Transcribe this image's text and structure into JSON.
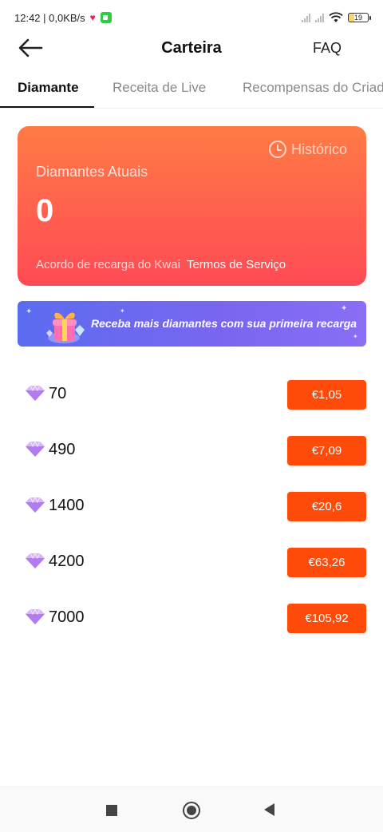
{
  "status_bar": {
    "time_speed": "12:42 | 0,0KB/s",
    "battery": "19"
  },
  "header": {
    "title": "Carteira",
    "faq_label": "FAQ"
  },
  "tabs": [
    {
      "label": "Diamante",
      "active": true
    },
    {
      "label": "Receita de Live",
      "active": false
    },
    {
      "label": "Recompensas do Criador",
      "active": false
    }
  ],
  "wallet_card": {
    "history_label": "Histórico",
    "balance_label": "Diamantes Atuais",
    "balance_value": "0",
    "agreement_text": "Acordo de recarga do Kwai",
    "terms_link": "Termos de Serviço"
  },
  "banner": {
    "text": "Receba mais diamantes com sua primeira recarga"
  },
  "packages": [
    {
      "amount": "70",
      "price": "€1,05"
    },
    {
      "amount": "490",
      "price": "€7,09"
    },
    {
      "amount": "1400",
      "price": "€20,6"
    },
    {
      "amount": "4200",
      "price": "€63,26"
    },
    {
      "amount": "7000",
      "price": "€105,92"
    }
  ],
  "colors": {
    "accent": "#ff4b0a",
    "card_top": "#ff7b45",
    "card_bottom": "#ff4a55",
    "banner": "#6a68f0"
  }
}
